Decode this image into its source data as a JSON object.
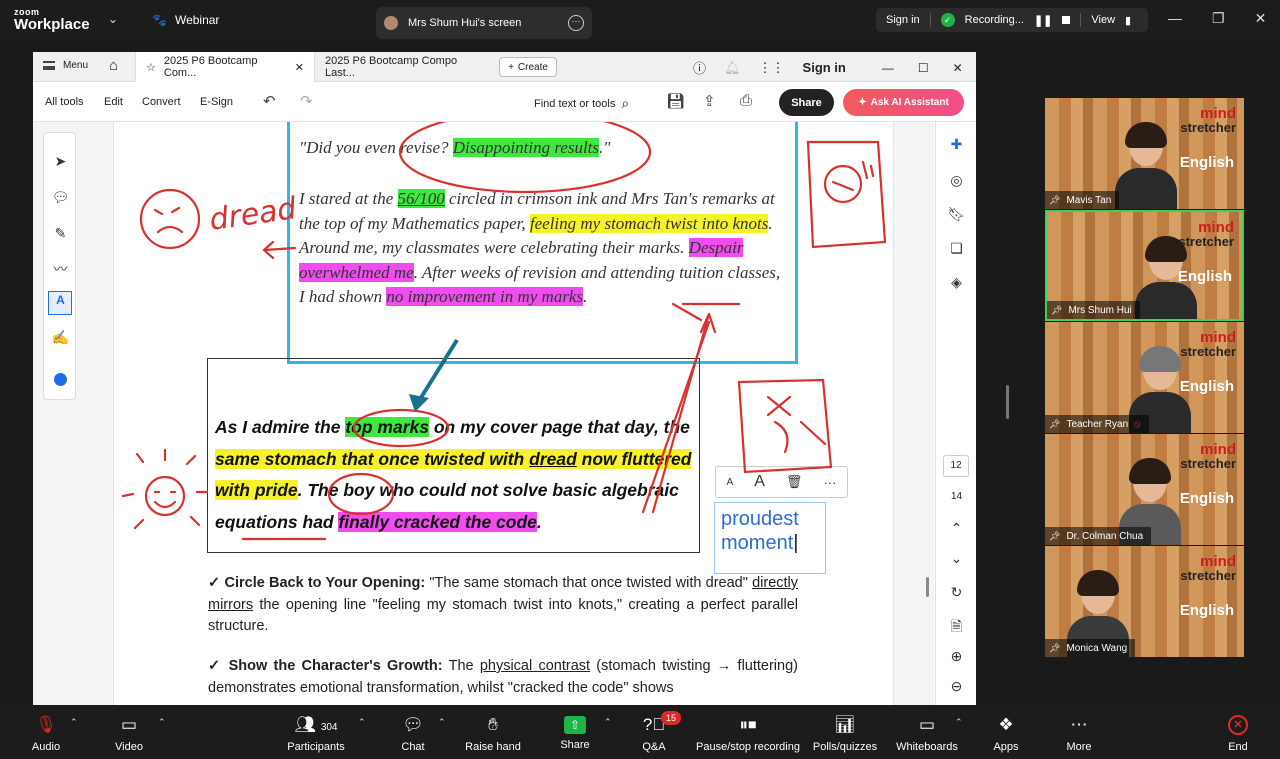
{
  "zoom": {
    "logo_top": "zoom",
    "logo_bottom": "Workplace",
    "webinar_label": "Webinar",
    "share_tab_title": "Mrs Shum Hui's screen",
    "sign_in": "Sign in",
    "recording_label": "Recording...",
    "view_label": "View"
  },
  "acrobat": {
    "menu_label": "Menu",
    "tabs": [
      {
        "label": "2025 P6 Bootcamp Com..."
      },
      {
        "label": "2025 P6 Bootcamp Compo Last..."
      }
    ],
    "create_label": "Create",
    "sign_in": "Sign in",
    "tools": {
      "all_tools": "All tools",
      "edit": "Edit",
      "convert": "Convert",
      "esign": "E-Sign",
      "find": "Find text or tools",
      "share": "Share",
      "ai": "Ask AI Assistant"
    },
    "page_current": "12",
    "page_total": "14"
  },
  "document": {
    "quote_pre": "\"Did you even revise? ",
    "quote_hl": "Disappointing results",
    "quote_post": ".\"",
    "p1": {
      "a": "I stared at the ",
      "score": "56/100",
      "b": " circled in crimson ink and Mrs Tan's remarks at the top of my Mathematics paper, ",
      "hl1": "feeling my stomach twist into knots",
      "c": ". Around me, my classmates were celebrating their marks. ",
      "hl2": "Despair overwhelmed me",
      "d": ". After weeks of revision and attending tuition classes, I had shown ",
      "hl3": "no improvement in my marks",
      "e": "."
    },
    "p2": {
      "a": "As I admire the ",
      "hl1": "top marks",
      "b": " on my cover page that day, the ",
      "hl2a": "same stomach that once twisted with ",
      "hl2u": "dread",
      "hl2b": " now fluttered with pride",
      "c": ". The boy who could not solve basic algebraic equations had ",
      "hl3": "finally cracked the code",
      "d": "."
    },
    "textbox_line1": "proudest",
    "textbox_line2": "moment",
    "b1": {
      "head": "✓ Circle Back to Your Opening:",
      "t1": " \"The same stomach that once twisted with dread\" ",
      "u1": "directly mirrors",
      "t2": " the opening line \"feeling my stomach twist into knots,\" creating a perfect parallel structure."
    },
    "b2": {
      "head": "✓ Show the Character's Growth:",
      "t1": " The ",
      "u1": "physical contrast",
      "t2": " (stomach twisting → fluttering) demonstrates emotional transformation, whilst \"cracked the code\" shows"
    },
    "handwriting_dread": "dread"
  },
  "participants": [
    {
      "name": "Mavis Tan"
    },
    {
      "name": "Mrs Shum Hui"
    },
    {
      "name": "Teacher Ryan"
    },
    {
      "name": "Dr. Colman Chua"
    },
    {
      "name": "Monica Wang"
    }
  ],
  "tile_brand": {
    "line1": "mind",
    "line2": "stretcher",
    "english": "English"
  },
  "bottombar": {
    "audio": "Audio",
    "video": "Video",
    "participants": "Participants",
    "participants_count": "304",
    "chat": "Chat",
    "raise_hand": "Raise hand",
    "share": "Share",
    "qa": "Q&A",
    "qa_badge": "15",
    "pause_rec": "Pause/stop recording",
    "polls": "Polls/quizzes",
    "whiteboards": "Whiteboards",
    "apps": "Apps",
    "more": "More",
    "end": "End"
  },
  "colors": {
    "highlight_green": "#3ee83e",
    "highlight_yellow": "#f6f22a",
    "highlight_magenta": "#f04cf0",
    "annotation_red": "#d8322e",
    "box_blue": "#2fb8e6",
    "zoom_green": "#1fb34a",
    "end_red": "#e02828"
  }
}
